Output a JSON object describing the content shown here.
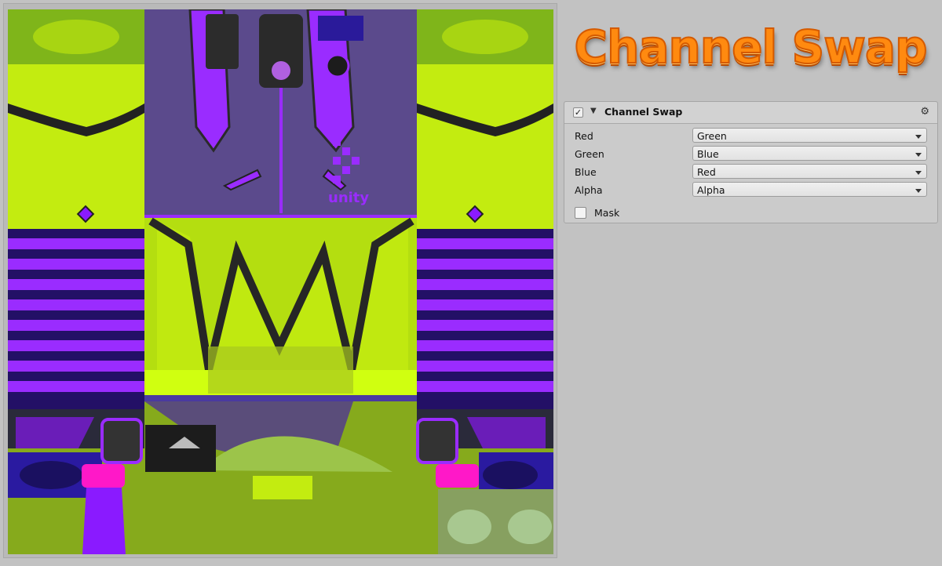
{
  "title": {
    "text": "Channel Swap"
  },
  "component": {
    "title": "Channel Swap",
    "enabled_check": "✓",
    "foldout": "▼",
    "settings_icon": "gear-icon",
    "settings_glyph": "⚙",
    "rows": [
      {
        "label": "Red",
        "value": "Green"
      },
      {
        "label": "Green",
        "value": "Blue"
      },
      {
        "label": "Blue",
        "value": "Red"
      },
      {
        "label": "Alpha",
        "value": "Alpha"
      }
    ],
    "mask": {
      "label": "Mask",
      "checked": false
    }
  },
  "texture": {
    "decal_text": "unity"
  },
  "colors": {
    "background": "#c2c2c2",
    "title_orange": "#ff8a10",
    "texture_yellow_green": "#c8f010",
    "texture_purple": "#8a1aff",
    "texture_navy": "#201060"
  }
}
